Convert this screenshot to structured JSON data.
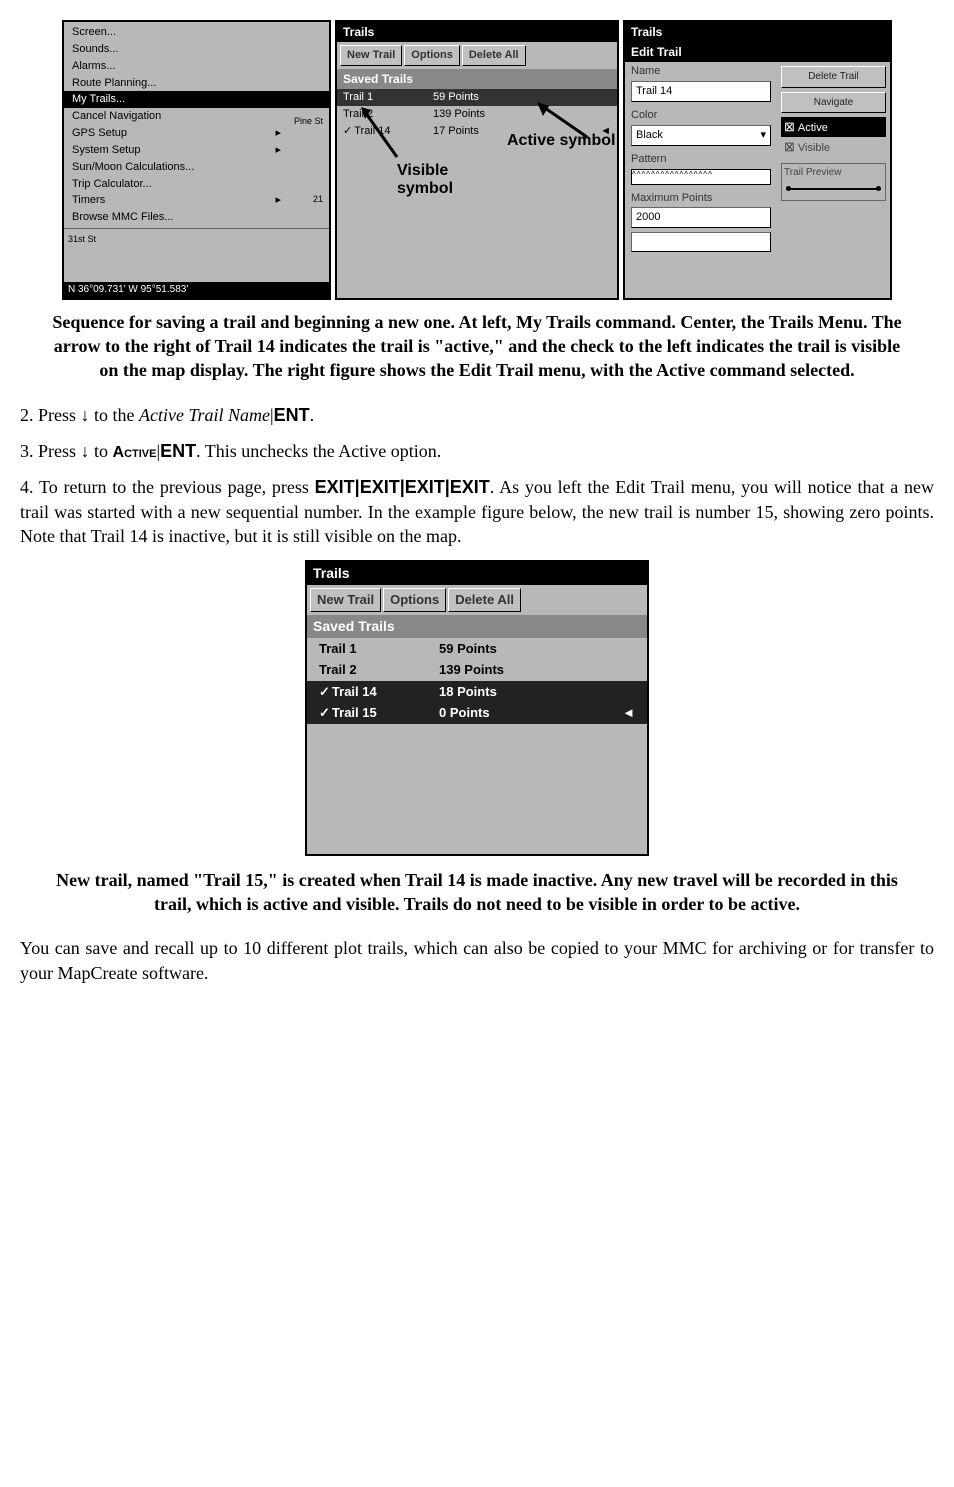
{
  "figure1": {
    "left_panel": {
      "menu_items": [
        {
          "label": "Screen...",
          "arrow": false
        },
        {
          "label": "Sounds...",
          "arrow": false
        },
        {
          "label": "Alarms...",
          "arrow": false
        },
        {
          "label": "Route Planning...",
          "arrow": false
        },
        {
          "label": "My Trails...",
          "arrow": false,
          "selected": true
        },
        {
          "label": "Cancel Navigation",
          "arrow": false
        },
        {
          "label": "GPS Setup",
          "arrow": true
        },
        {
          "label": "System Setup",
          "arrow": true
        },
        {
          "label": "Sun/Moon Calculations...",
          "arrow": false
        },
        {
          "label": "Trip Calculator...",
          "arrow": false
        },
        {
          "label": "Timers",
          "arrow": true
        },
        {
          "label": "Browse MMC Files...",
          "arrow": false
        }
      ],
      "map_labels": {
        "street1": "Pine St",
        "street2": "St",
        "num": "21"
      },
      "coords": "N  36°09.731'  W  95°51.583'"
    },
    "center_panel": {
      "title": "Trails",
      "buttons": {
        "new": "New Trail",
        "options": "Options",
        "delete": "Delete All"
      },
      "section": "Saved Trails",
      "rows": [
        {
          "name": "Trail 1",
          "pts": "59 Points",
          "sel": true,
          "check": false
        },
        {
          "name": "Trail 2",
          "pts": "139 Points",
          "sel": false,
          "check": false
        },
        {
          "name": "Trail 14",
          "pts": "17 Points",
          "sel": false,
          "check": true,
          "arrow": true
        }
      ],
      "annotations": {
        "active": "Active symbol",
        "visible": "Visible symbol"
      }
    },
    "right_panel": {
      "title": "Trails",
      "subtitle": "Edit Trail",
      "name_label": "Name",
      "name_value": "Trail 14",
      "color_label": "Color",
      "color_value": "Black",
      "pattern_label": "Pattern",
      "max_label": "Maximum Points",
      "max_value": "2000",
      "buttons": {
        "delete": "Delete Trail",
        "navigate": "Navigate"
      },
      "checkboxes": {
        "active": "Active",
        "visible": "Visible"
      },
      "preview_label": "Trail Preview"
    }
  },
  "caption1": "Sequence for saving a trail and beginning a new one. At left, My Trails command. Center, the Trails Menu. The arrow to the right of Trail 14 indicates the trail is \"active,\" and the check to the left indicates the trail is visible on the map display. The right figure shows the Edit Trail menu, with the Active command selected.",
  "step2": {
    "prefix": "2. Press ↓ to the ",
    "italic": "Active Trail Name",
    "suffix": "|",
    "key": "ENT",
    "end": "."
  },
  "step3": {
    "prefix": "3. Press ↓ to ",
    "cmd": "Active",
    "pipe": "|",
    "key": "ENT",
    "end": ". This unchecks the Active option."
  },
  "step4": {
    "prefix": "4. To return to the previous page, press ",
    "keys": "EXIT|EXIT|EXIT|EXIT",
    "rest": ". As you left the Edit Trail menu, you will notice that a new trail was started with a new sequential number. In the example figure below, the new trail is number 15, showing zero points. Note that Trail 14 is inactive, but it is still visible on the map."
  },
  "figure2": {
    "title": "Trails",
    "buttons": {
      "new": "New Trail",
      "options": "Options",
      "delete": "Delete All"
    },
    "section": "Saved Trails",
    "rows": [
      {
        "name": "Trail 1",
        "pts": "59 Points",
        "sel": false,
        "check": false
      },
      {
        "name": "Trail 2",
        "pts": "139 Points",
        "sel": false,
        "check": false
      },
      {
        "name": "Trail 14",
        "pts": "18 Points",
        "sel": true,
        "check": true
      },
      {
        "name": "Trail 15",
        "pts": "0 Points",
        "sel": true,
        "check": true,
        "arrow": true
      }
    ]
  },
  "caption2": "New trail, named \"Trail 15,\" is created when Trail 14 is made inactive. Any new travel will be recorded in this trail, which is active and visible. Trails do not need to be visible in order to be active.",
  "para_final": "You can save and recall up to 10 different plot trails, which can also be copied to your MMC for archiving or for transfer to your MapCreate software."
}
